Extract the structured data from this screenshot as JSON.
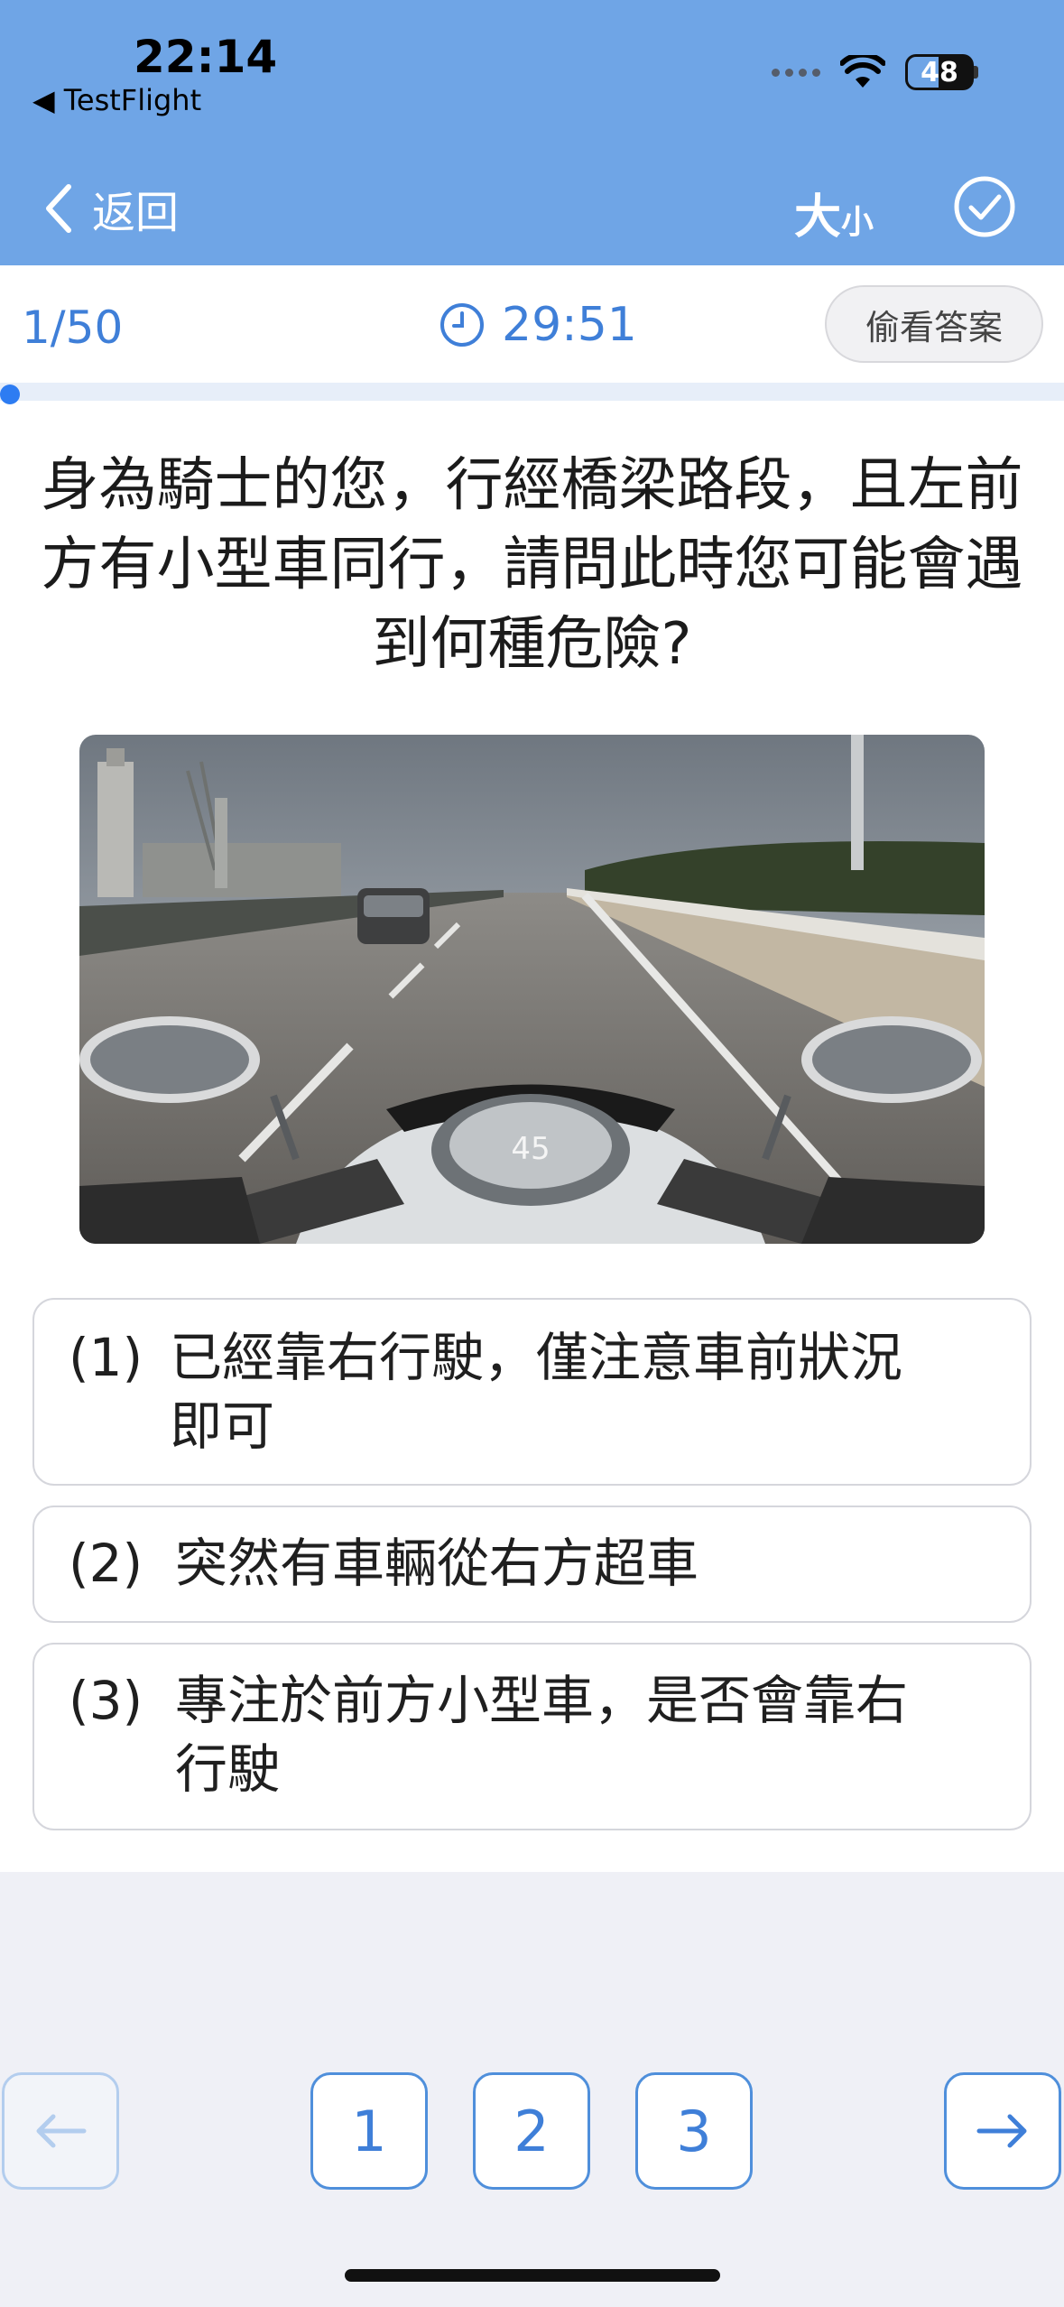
{
  "status_bar": {
    "time": "22:14",
    "back_app": "◀ TestFlight",
    "battery": "48"
  },
  "nav": {
    "back_label": "返回",
    "size_big": "大",
    "size_small": "小"
  },
  "quiz": {
    "counter": "1/50",
    "timer": "29:51",
    "peek_label": "偷看答案",
    "progress_fraction": 0.02,
    "question": "身為騎士的您，行經橋梁路段，且左前方有小型車同行，請問此時您可能會遇到何種危險?",
    "photo_speed": "45",
    "options": [
      {
        "num": "(1)",
        "text": "已經靠右行駛，僅注意車前狀況即可"
      },
      {
        "num": "(2)",
        "text": "突然有車輛從右方超車"
      },
      {
        "num": "(3)",
        "text": "專注於前方小型車，是否會靠右行駛"
      }
    ]
  },
  "bottom_nav": {
    "prev_icon": "arrow-left-icon",
    "next_icon": "arrow-right-icon",
    "answers": [
      "1",
      "2",
      "3"
    ]
  },
  "colors": {
    "header": "#6fa5e6",
    "accent": "#3f7fd8",
    "background": "#eff0f6"
  }
}
